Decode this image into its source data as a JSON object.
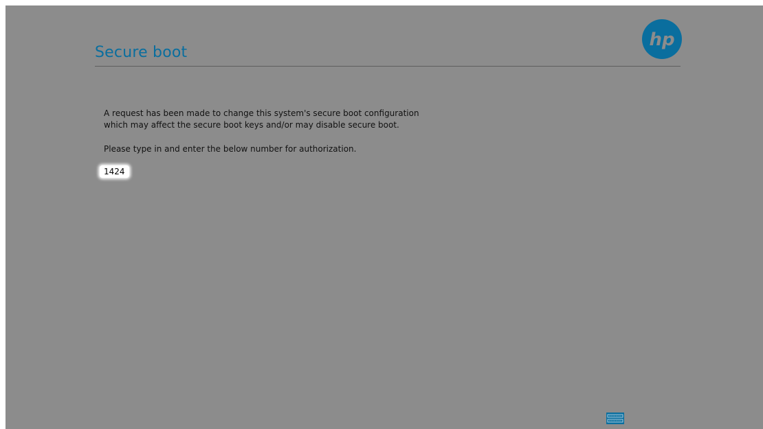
{
  "header": {
    "title": "Secure boot",
    "logo_text": "hp"
  },
  "main": {
    "message_line_1": "A request has been made to change this system's secure boot configuration",
    "message_line_2": "which may affect the secure boot keys and/or may disable secure boot.",
    "prompt": "Please type in and enter the below number for authorization.",
    "authorization_code": "1424"
  },
  "footer": {
    "icon": "keyboard-icon"
  },
  "colors": {
    "background": "#8c8c8c",
    "title": "#0a6e9e",
    "logo": "#0a6e9e",
    "text": "#111111"
  }
}
